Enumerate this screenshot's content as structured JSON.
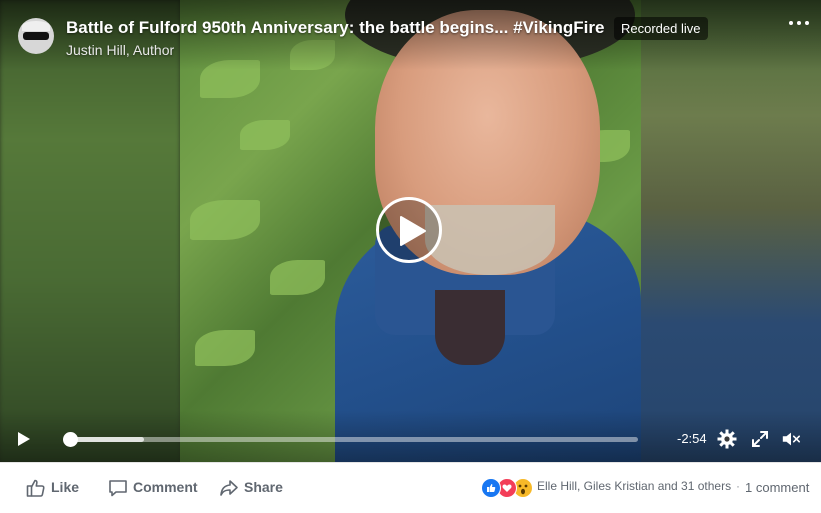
{
  "post": {
    "title": "Battle of Fulford 950th Anniversary: the battle begins... #VikingFire",
    "author": "Justin Hill, Author",
    "live_badge": "Recorded live",
    "avatar_icon": "avatar-sunglasses",
    "more_icon": "more-options-icon"
  },
  "player": {
    "time_remaining": "-2:54",
    "progress_fraction": 0.0,
    "buffered_fraction": 0.13,
    "icons": [
      "play-icon",
      "settings-gear-icon",
      "fullscreen-icon",
      "volume-muted-icon"
    ]
  },
  "actions": {
    "like_label": "Like",
    "comment_label": "Comment",
    "share_label": "Share"
  },
  "reactions": {
    "types": [
      "like",
      "love",
      "wow"
    ],
    "names": "Elle Hill, Giles Kristian and 31 others",
    "separator": "·",
    "comments": "1 comment"
  },
  "colors": {
    "like_blue": "#1877f2",
    "love_red": "#f33e58",
    "wow_yellow": "#f7b928",
    "text_gray": "#606770"
  }
}
